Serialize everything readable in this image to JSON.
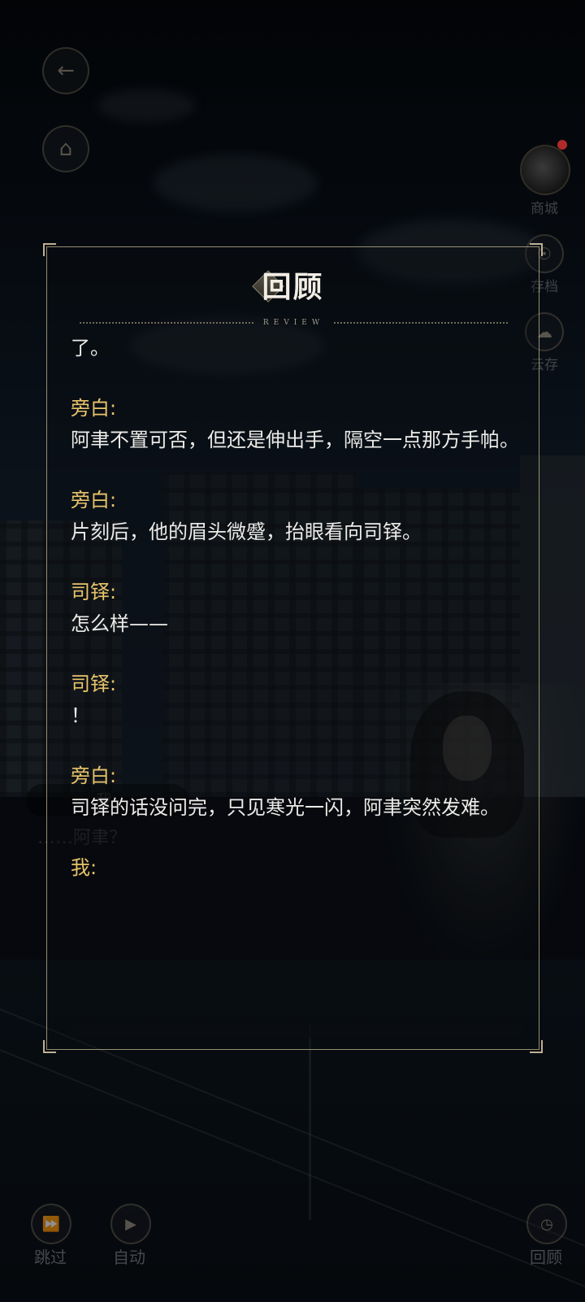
{
  "panel": {
    "title": "回顾",
    "subtitle": "REVIEW",
    "entries": [
      {
        "speaker": "",
        "text": "了。"
      },
      {
        "speaker": "旁白:",
        "text": "阿聿不置可否，但还是伸出手，隔空一点那方手帕。"
      },
      {
        "speaker": "旁白:",
        "text": "片刻后，他的眉头微蹙，抬眼看向司铎。"
      },
      {
        "speaker": "司铎:",
        "text": "怎么样——"
      },
      {
        "speaker": "司铎:",
        "text": "！"
      },
      {
        "speaker": "旁白:",
        "text": "司铎的话没问完，只见寒光一闪，阿聿突然发难。"
      },
      {
        "speaker": "我:",
        "text": ""
      }
    ]
  },
  "side_menu": {
    "shop": "商城",
    "save": "存档",
    "cloud": "云存"
  },
  "dialogue_ghost": {
    "name": "我",
    "line": "……阿聿？"
  },
  "bottom_bar": {
    "skip": "跳过",
    "auto": "自动",
    "review": "回顾"
  },
  "icons": {
    "back": "back-arrow-icon",
    "home": "home-icon",
    "skip": "fast-forward-icon",
    "auto": "play-icon",
    "review": "clock-icon"
  },
  "colors": {
    "speaker": "#e8c46a",
    "text": "#ecebe8",
    "frame": "#c8b996"
  }
}
